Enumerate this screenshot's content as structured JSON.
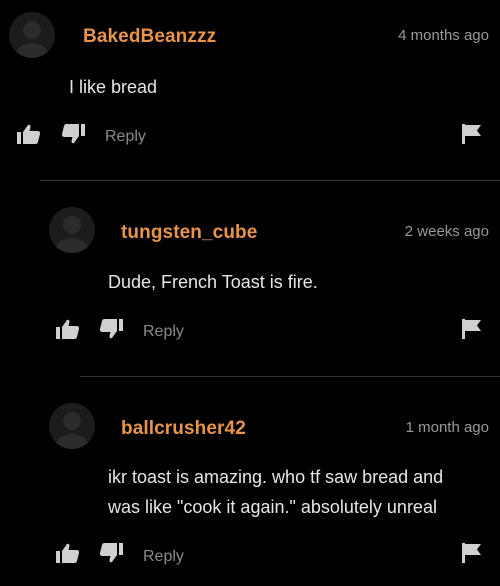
{
  "colors": {
    "background": "#000000",
    "username": "#e8944a",
    "timestamp": "#9a9a9a",
    "body_text": "#e6e6e6",
    "action_icon": "#d0d0d0",
    "reply_label": "#8a8a8a",
    "divider": "#333333"
  },
  "comments": [
    {
      "username": "BakedBeanzzz",
      "timestamp": "4 months ago",
      "text": "I like bread",
      "reply_label": "Reply",
      "icons": [
        "avatar",
        "thumbs-up-icon",
        "thumbs-down-icon",
        "flag-icon"
      ]
    },
    {
      "username": "tungsten_cube",
      "timestamp": "2 weeks ago",
      "text": "Dude, French Toast is fire.",
      "reply_label": "Reply",
      "icons": [
        "avatar",
        "thumbs-up-icon",
        "thumbs-down-icon",
        "flag-icon"
      ]
    },
    {
      "username": "ballcrusher42",
      "timestamp": "1 month ago",
      "text_line1": "ikr toast is amazing. who tf saw bread and",
      "text_line2": "was like \"cook it again.\" absolutely unreal",
      "reply_label": "Reply",
      "icons": [
        "avatar",
        "thumbs-up-icon",
        "thumbs-down-icon",
        "flag-icon"
      ]
    }
  ]
}
